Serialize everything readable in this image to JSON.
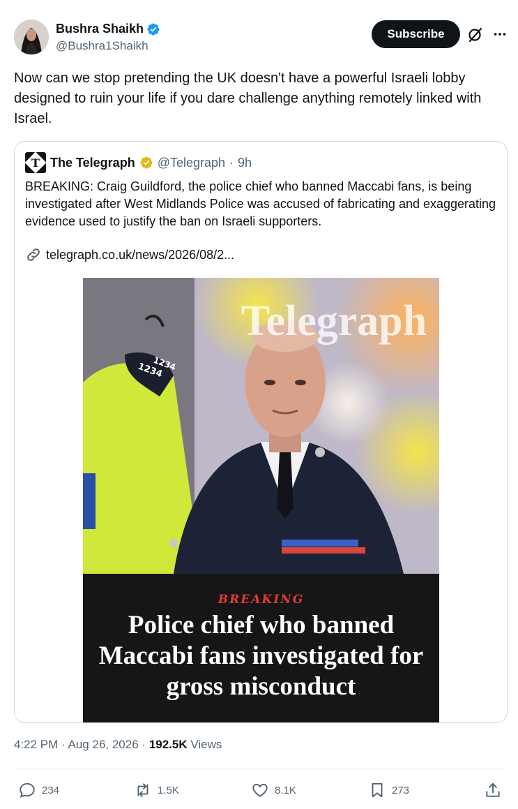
{
  "author": {
    "name": "Bushra Shaikh",
    "handle": "@Bushra1Shaikh",
    "subscribe_label": "Subscribe"
  },
  "tweet": {
    "text": "Now can we stop pretending the UK doesn't have a powerful Israeli lobby designed to ruin your life if you dare challenge anything remotely linked with Israel."
  },
  "quote": {
    "name": "The Telegraph",
    "handle": "@Telegraph",
    "separator": "·",
    "time": "9h",
    "text": "BREAKING: Craig Guildford, the police chief who banned Maccabi fans, is being investigated after West Midlands Police was accused of fabricating and exaggerating evidence used to justify the ban on Israeli supporters.",
    "link": "telegraph.co.uk/news/2026/08/2...",
    "image": {
      "watermark": "Telegraph",
      "badge_number": "1234",
      "kicker": "BREAKING",
      "headline": "Police chief who banned Maccabi fans investigated for gross misconduct"
    }
  },
  "meta": {
    "time": "4:22 PM",
    "separator": "·",
    "date": "Aug 26, 2026",
    "views_count": "192.5K",
    "views_label": "Views"
  },
  "actions": {
    "replies": "234",
    "reposts": "1.5K",
    "likes": "8.1K",
    "bookmarks": "273"
  },
  "colors": {
    "text": "#0f1419",
    "secondary": "#536471",
    "verified_blue": "#1d9bf0",
    "verified_gold": "#e2b719",
    "kicker_red": "#e13a37"
  },
  "icons": [
    "verified-badge-icon",
    "grok-icon",
    "more-icon",
    "telegraph-logo-icon",
    "gold-badge-icon",
    "link-icon",
    "reply-icon",
    "repost-icon",
    "like-icon",
    "bookmark-icon",
    "share-icon"
  ]
}
